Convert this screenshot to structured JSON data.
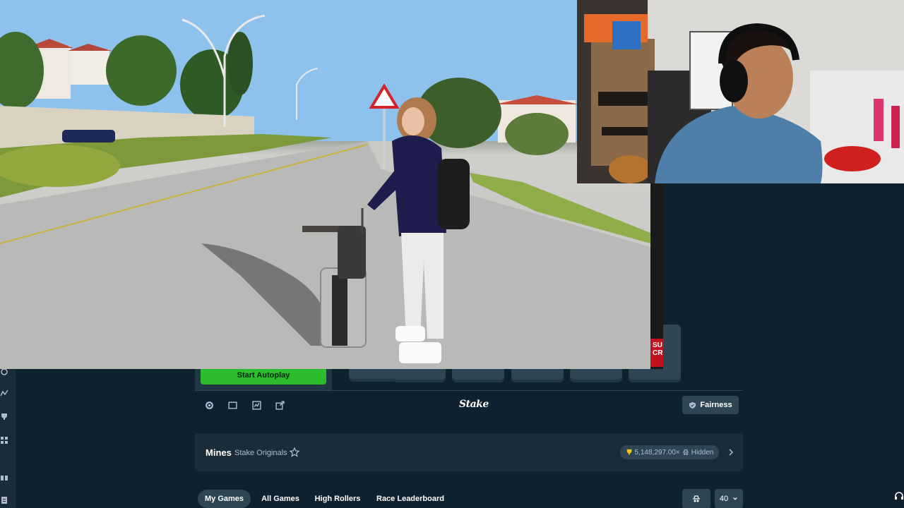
{
  "controls": {
    "autoplay_label": "Start Autoplay"
  },
  "toolbar": {
    "logo_text": "Stake",
    "fairness_label": "Fairness"
  },
  "game_info": {
    "title": "Mines",
    "subtitle": "Stake Originals",
    "max_multiplier": "5,148,297.00×",
    "hidden_label": "Hidden"
  },
  "tabs": [
    {
      "label": "My Games",
      "active": true
    },
    {
      "label": "All Games",
      "active": false
    },
    {
      "label": "High Rollers",
      "active": false
    },
    {
      "label": "Race Leaderboard",
      "active": false
    }
  ],
  "table_controls": {
    "page_size": "40"
  },
  "overlay": {
    "promo_text": "SU CR"
  },
  "colors": {
    "bg": "#0f212e",
    "panel": "#213743",
    "accent_green": "#2bbd2b",
    "pill": "#2f4553",
    "promo_red": "#c1121f"
  }
}
